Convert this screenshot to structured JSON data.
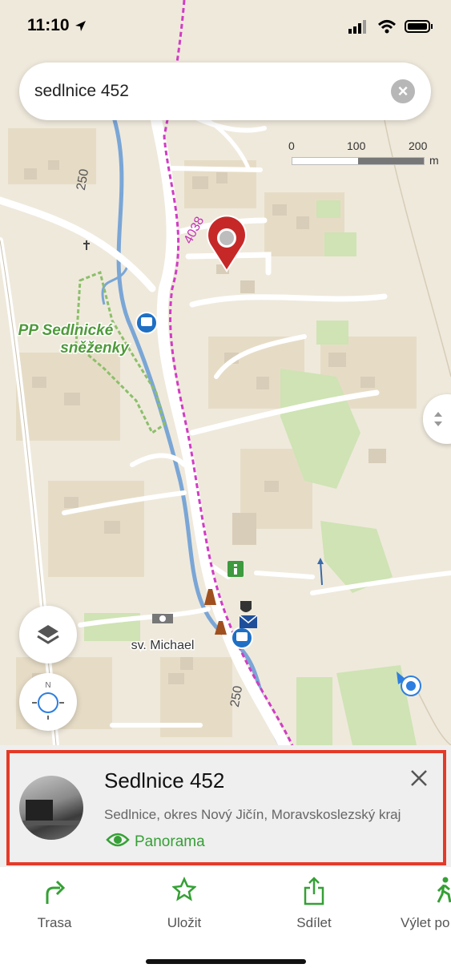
{
  "status_bar": {
    "time": "11:10"
  },
  "search": {
    "value": "sedlnice 452"
  },
  "scale": {
    "labels": [
      "0",
      "100",
      "200"
    ],
    "unit": "m"
  },
  "map_labels": {
    "reserve_line1": "PP Sedlnické",
    "reserve_line2": "sněženky",
    "church": "sv. Michael",
    "road": "4038",
    "elev_top": "250",
    "elev_bottom": "250"
  },
  "place_card": {
    "title": "Sedlnice 452",
    "address": "Sedlnice, okres Nový Jičín, Moravskoslezský kraj",
    "panorama_label": "Panorama"
  },
  "tab_bar": {
    "items": [
      {
        "label": "Trasa",
        "icon": "route-icon"
      },
      {
        "label": "Uložit",
        "icon": "star-icon"
      },
      {
        "label": "Sdílet",
        "icon": "share-icon"
      },
      {
        "label": "Výlet po",
        "icon": "hiking-icon"
      }
    ]
  },
  "colors": {
    "accent_green": "#35a035",
    "highlight_red": "#e53a28",
    "pin_red": "#c62828",
    "road_pink": "#d13cc4",
    "river_blue": "#7aa6d6"
  }
}
